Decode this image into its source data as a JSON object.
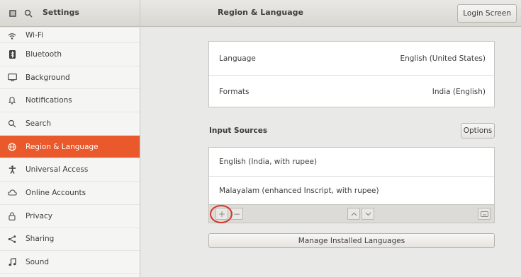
{
  "header": {
    "app_title": "Settings",
    "page_title": "Region & Language",
    "login_screen_label": "Login Screen"
  },
  "sidebar": {
    "items": [
      {
        "label": "Wi-Fi",
        "icon": "wifi-icon"
      },
      {
        "label": "Bluetooth",
        "icon": "bluetooth-icon"
      },
      {
        "label": "Background",
        "icon": "background-icon"
      },
      {
        "label": "Notifications",
        "icon": "bell-icon"
      },
      {
        "label": "Search",
        "icon": "search-icon"
      },
      {
        "label": "Region & Language",
        "icon": "globe-icon",
        "active": true
      },
      {
        "label": "Universal Access",
        "icon": "accessibility-icon"
      },
      {
        "label": "Online Accounts",
        "icon": "cloud-icon"
      },
      {
        "label": "Privacy",
        "icon": "lock-icon"
      },
      {
        "label": "Sharing",
        "icon": "share-icon"
      },
      {
        "label": "Sound",
        "icon": "music-note-icon"
      }
    ]
  },
  "language_card": {
    "language_label": "Language",
    "language_value": "English (United States)",
    "formats_label": "Formats",
    "formats_value": "India (English)"
  },
  "input_sources": {
    "title": "Input Sources",
    "options_label": "Options",
    "sources": [
      "English (India, with rupee)",
      "Malayalam (enhanced Inscript, with rupee)"
    ],
    "add_symbol": "+",
    "remove_symbol": "−"
  },
  "manage_languages_label": "Manage Installed Languages",
  "colors": {
    "accent": "#e9592b",
    "highlight_ring": "#d4372c"
  }
}
